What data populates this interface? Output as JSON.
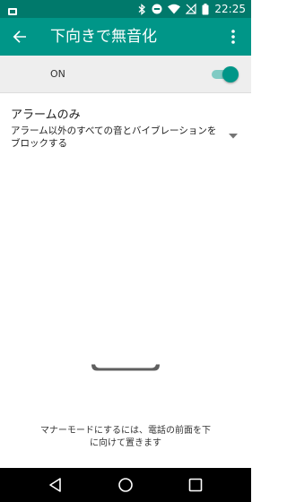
{
  "status_bar": {
    "time": "22:25",
    "icons": [
      "android-notification-icon",
      "bluetooth-icon",
      "do-not-disturb-icon",
      "wifi-icon",
      "no-signal-icon",
      "battery-icon"
    ]
  },
  "app_bar": {
    "title": "下向きで無音化",
    "back_icon": "arrow-back-icon",
    "more_icon": "more-vert-icon"
  },
  "master_switch": {
    "label": "ON",
    "checked": true
  },
  "setting": {
    "title": "アラームのみ",
    "summary": "アラーム以外のすべての音とバイブレーションをブロックする",
    "dropdown_icon": "dropdown-arrow-icon"
  },
  "hint": {
    "text": "マナーモードにするには、電話の前面を下に向けて置きます"
  },
  "nav_bar": {
    "icons": [
      "nav-back-icon",
      "nav-home-icon",
      "nav-recents-icon"
    ]
  },
  "colors": {
    "status_bar": "#00796b",
    "app_bar": "#009688",
    "switch_row_bg": "#eeeeee",
    "toggle_track": "#80cbc4",
    "toggle_thumb": "#009688",
    "nav_bar": "#000000"
  }
}
